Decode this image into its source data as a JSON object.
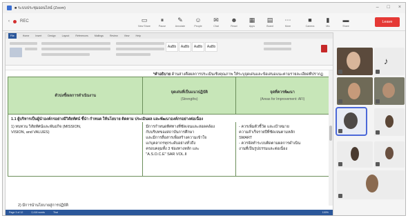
{
  "window": {
    "title": "■ ระบบประชุมออนไลน์ (Zoom)"
  },
  "meeting": {
    "status": "REC",
    "tools": [
      {
        "icon": "monitor-icon",
        "glyph": "▭",
        "label": "New Share"
      },
      {
        "icon": "pause-icon",
        "glyph": "⏸",
        "label": "Pause"
      },
      {
        "icon": "annotate-icon",
        "glyph": "✎",
        "label": "Annotate"
      },
      {
        "icon": "participants-icon",
        "glyph": "☺",
        "label": "People"
      },
      {
        "icon": "chat-icon",
        "glyph": "✉",
        "label": "Chat"
      },
      {
        "icon": "reactions-icon",
        "glyph": "☻",
        "label": "React"
      },
      {
        "icon": "apps-icon",
        "glyph": "▦",
        "label": "Apps"
      },
      {
        "icon": "whiteboard-icon",
        "glyph": "▤",
        "label": "Board"
      },
      {
        "icon": "more-icon",
        "glyph": "⋯",
        "label": "More"
      }
    ],
    "right_tools": [
      {
        "icon": "camera-icon",
        "glyph": "■",
        "label": "Camera"
      },
      {
        "icon": "mic-icon",
        "glyph": "▮",
        "label": "Mic"
      },
      {
        "icon": "screen-icon",
        "glyph": "▬",
        "label": "Share"
      }
    ],
    "leave_label": "Leave"
  },
  "ribbon": {
    "tabs": [
      "File",
      "Home",
      "Insert",
      "Design",
      "Layout",
      "References",
      "Mailings",
      "Review",
      "View",
      "Help"
    ],
    "styles": [
      "AaBb",
      "AaBb",
      "AaBb",
      "AaBb"
    ]
  },
  "document": {
    "header_note_bold": "*คำอธิบาย",
    "header_note_text": "ด้านล่างคือผลการประเมินเชิงคุณภาพ ให้ระบุจุดเด่นและข้อเสนอแนะตามรายละเอียดที่ปรากฏ",
    "columns": [
      {
        "title": "ตัวบ่งชี้/ผลการดำเนินงาน",
        "sub": ""
      },
      {
        "title": "จุดเด่นที่เป็นแนวปฏิบัติ",
        "sub": "(Strengths)"
      },
      {
        "title": "จุดที่ควรพัฒนา",
        "sub": "(Areas for Improvement: AFI)"
      }
    ],
    "row_heading": "1.1 ผู้บริหารเป็นผู้นำองค์กรอย่างมีวิสัยทัศน์ ชี้นำ กำหนด ให้นโยบาย ติดตาม ประเมินผล และพัฒนาองค์กรอย่างต่อเนื่อง",
    "col1_lines": [
      "1) ทบทวน วิสัยทัศน์และพันธกิจ (MISSION,",
      "VISION, and VALUES)"
    ],
    "col2_lines": [
      "มีการกำหนดทิศทางที่ชัดเจนและสอดคล้อง",
      "กับบริบทของสถาบันการศึกษา",
      "และมีการสื่อสารเพื่อสร้างความเข้าใจ",
      "แก่บุคลากรทุกระดับอย่างทั่วถึง",
      "ครอบคลุมทั้ง 3 ช่องทางหลัก และ",
      "\"A.S.O.C.E\" SAR VOL.II"
    ],
    "col3_lines": [
      "- ควรเพิ่มตัวชี้วัด และเป้าหมาย",
      "ความสำเร็จรายปีที่ชัดเจนตามหลัก",
      "SMART",
      "- ควรจัดทำระบบติดตามผลการดำเนิน",
      "งานที่เป็นรูปธรรมและต่อเนื่อง"
    ],
    "next_row_partial": "2) มีการนำนโยบายสู่การปฏิบัติ"
  },
  "statusbar": {
    "page": "Page 3 of 12",
    "words": "2,418 words",
    "lang": "Thai",
    "zoom": "100%"
  },
  "participants": [
    {
      "id": "p1",
      "kind": "video"
    },
    {
      "id": "p2",
      "kind": "avatar"
    },
    {
      "id": "p3",
      "kind": "video"
    },
    {
      "id": "p4",
      "kind": "video"
    },
    {
      "id": "p5",
      "kind": "video"
    },
    {
      "id": "p6",
      "kind": "avatar"
    },
    {
      "id": "p7",
      "kind": "avatar"
    },
    {
      "id": "p8",
      "kind": "avatar"
    },
    {
      "id": "p9",
      "kind": "avatar"
    }
  ],
  "colors": {
    "accent": "#4b68d8",
    "leave": "#e53935",
    "table_header": "#c7e6b8",
    "word_blue": "#2b579a"
  }
}
